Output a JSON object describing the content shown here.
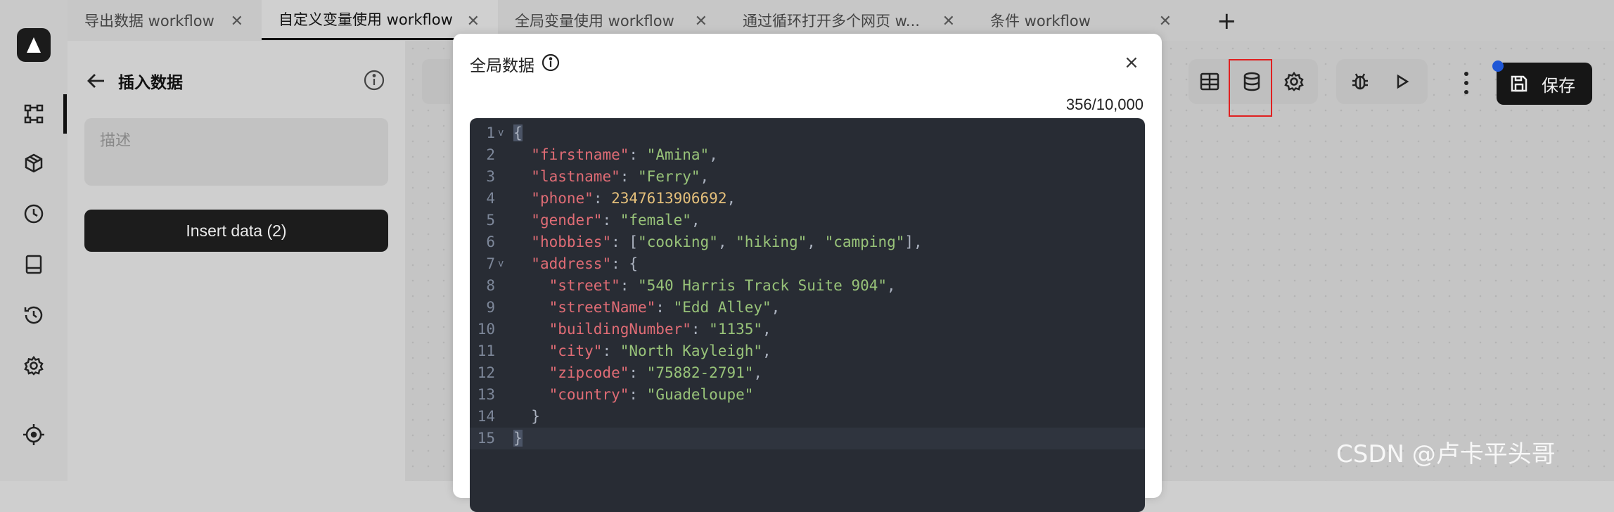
{
  "tabs": [
    {
      "label": "导出数据 workflow",
      "active": false
    },
    {
      "label": "自定义变量使用 workflow",
      "active": true
    },
    {
      "label": "全局变量使用 workflow",
      "active": false
    },
    {
      "label": "通过循环打开多个网页 w...",
      "active": false
    },
    {
      "label": "条件 workflow",
      "active": false
    }
  ],
  "tab_add_label": "+",
  "sidebar": {
    "icons": [
      "workflow-icon",
      "package-icon",
      "clock-icon",
      "panel-icon",
      "history-icon",
      "gear-icon",
      "crosshair-icon"
    ]
  },
  "panel": {
    "title": "插入数据",
    "description_placeholder": "描述",
    "insert_button": "Insert data (2)"
  },
  "toolbar": {
    "save_label": "保存",
    "accent_dot_color": "#1f57d6",
    "highlight_color": "#e02020"
  },
  "modal": {
    "title": "全局数据",
    "close_label": "×",
    "counter": "356/10,000",
    "code_lines": [
      {
        "num": "1",
        "fold": true,
        "text": "{"
      },
      {
        "num": "2",
        "fold": false,
        "key": "firstname",
        "value": "\"Amina\"",
        "tail": ","
      },
      {
        "num": "3",
        "fold": false,
        "key": "lastname",
        "value": "\"Ferry\"",
        "tail": ","
      },
      {
        "num": "4",
        "fold": false,
        "key": "phone",
        "value": "2347613906692",
        "tail": ","
      },
      {
        "num": "5",
        "fold": false,
        "key": "gender",
        "value": "\"female\"",
        "tail": ","
      },
      {
        "num": "6",
        "fold": false,
        "key": "hobbies",
        "value": "[\"cooking\", \"hiking\", \"camping\"]",
        "tail": ","
      },
      {
        "num": "7",
        "fold": true,
        "key": "address",
        "value": "{",
        "tail": ""
      },
      {
        "num": "8",
        "fold": false,
        "key": "street",
        "value": "\"540 Harris Track Suite 904\"",
        "tail": ","
      },
      {
        "num": "9",
        "fold": false,
        "key": "streetName",
        "value": "\"Edd Alley\"",
        "tail": ","
      },
      {
        "num": "10",
        "fold": false,
        "key": "buildingNumber",
        "value": "\"1135\"",
        "tail": ","
      },
      {
        "num": "11",
        "fold": false,
        "key": "city",
        "value": "\"North Kayleigh\"",
        "tail": ","
      },
      {
        "num": "12",
        "fold": false,
        "key": "zipcode",
        "value": "\"75882-2791\"",
        "tail": ","
      },
      {
        "num": "13",
        "fold": false,
        "key": "country",
        "value": "\"Guadeloupe\"",
        "tail": ""
      },
      {
        "num": "14",
        "fold": false,
        "text": "}"
      },
      {
        "num": "15",
        "fold": false,
        "text": "}"
      }
    ]
  },
  "watermark": "CSDN @卢卡平头哥"
}
